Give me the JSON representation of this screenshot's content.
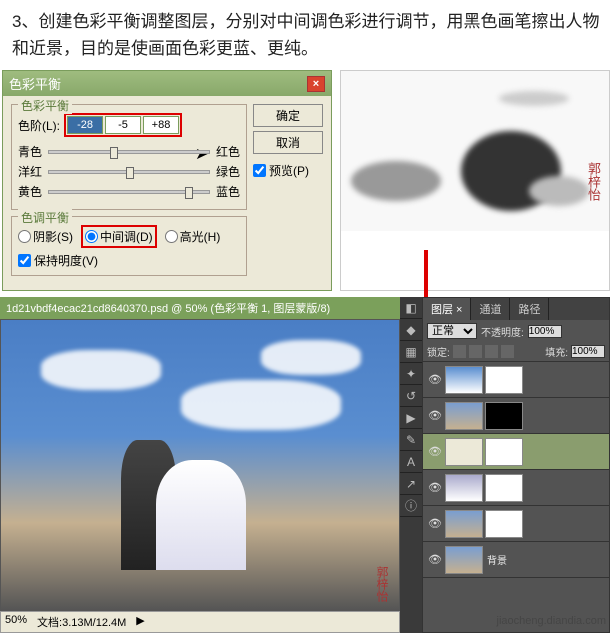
{
  "instruction": "3、创建色彩平衡调整图层，分别对中间调色彩进行调节，用黑色画笔擦出人物和近景，目的是使画面色彩更蓝、更纯。",
  "dialog": {
    "title": "色彩平衡",
    "ok": "确定",
    "cancel": "取消",
    "preview": "预览(P)",
    "group1_title": "色彩平衡",
    "levels_label": "色阶(L):",
    "levels": {
      "a": "-28",
      "b": "-5",
      "c": "+88"
    },
    "cyan": "青色",
    "red": "红色",
    "magenta": "洋红",
    "green": "绿色",
    "yellow": "黄色",
    "blue": "蓝色",
    "group2_title": "色调平衡",
    "shadows": "阴影(S)",
    "midtones": "中间调(D)",
    "highlights": "高光(H)",
    "preserve": "保持明度(V)"
  },
  "ps": {
    "title": "1d21vbdf4ecac21cd8640370.psd @ 50% (色彩平衡 1, 图层蒙版/8)",
    "status_zoom": "50%",
    "status_doc": "文档:3.13M/12.4M"
  },
  "layers": {
    "tab1": "图层 ×",
    "tab2": "通道",
    "tab3": "路径",
    "mode": "正常",
    "opacity_label": "不透明度:",
    "opacity": "100%",
    "lock_label": "锁定:",
    "fill_label": "填充:",
    "fill": "100%",
    "layer_bg": "背景"
  },
  "watermark": "jiaocheng.diandia.com"
}
